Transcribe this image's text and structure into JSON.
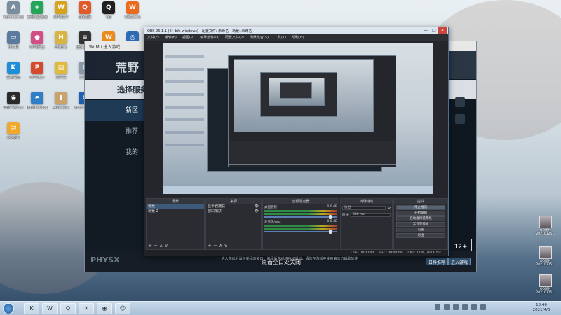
{
  "desktop_icons": [
    {
      "label": "Administrator",
      "glyph": "A",
      "color": "#7a8ea0"
    },
    {
      "label": "腾讯电脑管家",
      "glyph": "+",
      "color": "#25a55a"
    },
    {
      "label": "WPS文字",
      "glyph": "W",
      "color": "#d7a31c"
    },
    {
      "label": "QQ直播",
      "glyph": "Q",
      "color": "#e25a2a"
    },
    {
      "label": "QQ",
      "glyph": "Q",
      "color": "#1f1f1f"
    },
    {
      "label": "WeGame",
      "glyph": "W",
      "color": "#ec6a1c"
    },
    {
      "label": "计算机",
      "glyph": "▭",
      "color": "#5b7b9e"
    },
    {
      "label": "WPS网盘",
      "glyph": "●",
      "color": "#d24f86"
    },
    {
      "label": "History",
      "glyph": "H",
      "color": "#d9b443"
    },
    {
      "label": "迅游加速器",
      "glyph": "≡",
      "color": "#333333"
    },
    {
      "label": "WeChat",
      "glyph": "W",
      "color": "#ec8a1c"
    },
    {
      "label": "网络",
      "glyph": "◎",
      "color": "#2d6bb5"
    },
    {
      "label": "金山毒霸",
      "glyph": "K",
      "color": "#1e8fd6"
    },
    {
      "label": "WPS演示",
      "glyph": "P",
      "color": "#d44a2d"
    },
    {
      "label": "文件夹",
      "glyph": "▤",
      "color": "#e0b93d"
    },
    {
      "label": "回收站",
      "glyph": "♻",
      "color": "#8a9aa8"
    },
    {
      "label": "网易云音乐",
      "glyph": "♪",
      "color": "#2ea6d6"
    },
    {
      "label": "WPS PDF",
      "glyph": "▦",
      "color": "#c8332a"
    },
    {
      "label": "OBS Studio",
      "glyph": "◉",
      "color": "#2a2a2a"
    },
    {
      "label": "Internet Explorer",
      "glyph": "e",
      "color": "#2e7fc6"
    },
    {
      "label": "Autodesk",
      "glyph": "▮",
      "color": "#caa36a"
    },
    {
      "label": "XboxNetwork",
      "glyph": "✕",
      "color": "#1e5fb0"
    },
    {
      "label": "360安全浏览器",
      "glyph": "e",
      "color": "#3aa13a"
    },
    {
      "label": "Snapfiles",
      "glyph": "▯",
      "color": "#f2f2f2"
    },
    {
      "label": "QQ游戏",
      "glyph": "☺",
      "color": "#f0a82a"
    }
  ],
  "game_window": {
    "title": "WuMu 进入游戏",
    "logo": "荒野",
    "banner": "选择服务",
    "nav": [
      "新区",
      "推荐",
      "我的"
    ],
    "physx": "PHYSX",
    "footer_text": "进入游戏后请勿关闭本窗口，关闭后游戏将自动退出，请勿在游戏中使用第三方辅助软件",
    "start": "点击空白处关闭",
    "btn_left": "日料推荐",
    "btn_right": "进入游戏",
    "badge": "12+"
  },
  "obs": {
    "title": "OBS 26.1.1 (64-bit, windows) - 配置文件: 未命名 - 场景: 未命名",
    "menu": [
      "文件(F)",
      "编辑(E)",
      "视图(V)",
      "停靠部件(D)",
      "配置文件(P)",
      "场景集合(S)",
      "工具(T)",
      "帮助(H)"
    ],
    "window_controls": {
      "min": "—",
      "max": "□",
      "close": "✕"
    },
    "scenes": {
      "header": "场景",
      "items": [
        "场景",
        "场景 2"
      ]
    },
    "sources": {
      "header": "来源",
      "items": [
        "显示器捕获",
        "窗口捕获"
      ]
    },
    "mixer": {
      "header": "音频混音器",
      "channels": [
        {
          "name": "桌面音频",
          "level": "0.0 dB"
        },
        {
          "name": "麦克风/Aux",
          "level": "0.0 dB"
        }
      ]
    },
    "transitions": {
      "header": "转场特效",
      "type": "淡出",
      "duration_label": "时长",
      "duration": "300 ms"
    },
    "controls": {
      "header": "控件",
      "buttons": [
        "停止推流",
        "开始录制",
        "启动虚拟摄像机",
        "工作室模式",
        "设置",
        "退出"
      ]
    },
    "status": {
      "live": "LIVE: 00:00:00",
      "rec": "REC: 00:00:00",
      "cpu": "CPU: 4.0%, 30.00 fps"
    },
    "tool_glyphs": "+ − ∧ ∨"
  },
  "right_files": [
    {
      "label": "QQ图片20210325..."
    },
    {
      "label": "QQ图片20210325..."
    },
    {
      "label": "QQ图片20210325..."
    }
  ],
  "taskbar": {
    "time": "13:46",
    "date": "2021/4/6",
    "apps": [
      "K",
      "W",
      "Q",
      "✕",
      "◉",
      "☺"
    ]
  }
}
